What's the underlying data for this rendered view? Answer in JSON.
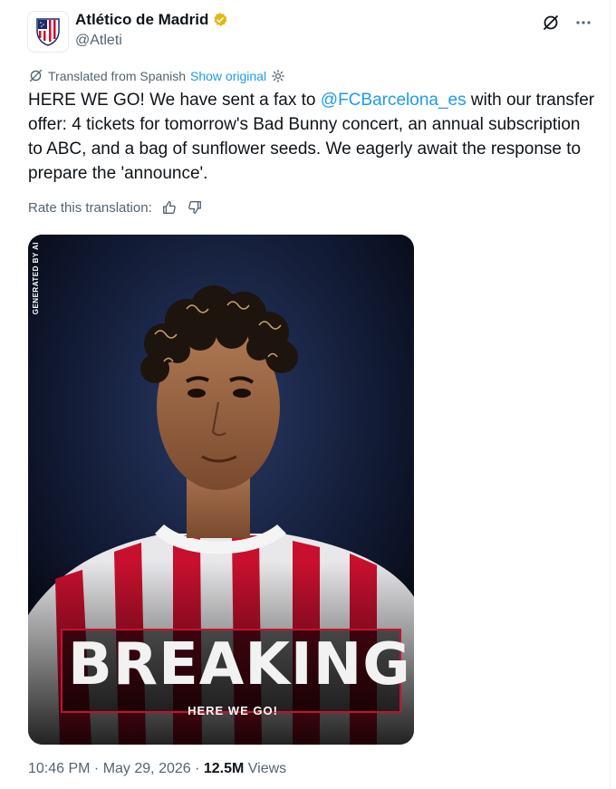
{
  "tweet": {
    "display_name": "Atlético de Madrid",
    "handle": "@Atleti",
    "translated_label": "Translated from Spanish",
    "show_original": "Show original",
    "text_part1": "HERE WE GO! We have sent a fax to ",
    "mention": "@FCBarcelona_es",
    "text_part2": " with our transfer offer: 4 tickets for tomorrow's Bad Bunny concert, an annual subscription to ABC, and a bag of sunflower seeds. We eagerly await the response to prepare the 'announce'.",
    "rate_label": "Rate this translation:",
    "time": "10:46 PM",
    "dot1": " · ",
    "date": "May 29, 2026",
    "dot2": " · ",
    "views_count": "12.5M",
    "views_label": " Views"
  },
  "media": {
    "generated_label": "GENERATED BY AI",
    "headline": "BREAKING",
    "subline": "HERE WE GO!"
  },
  "icons": {
    "verified": "verified-gold-icon",
    "grok": "grok-icon",
    "more": "more-icon",
    "translate": "translate-icon",
    "settings": "gear-icon",
    "thumbs_up": "thumbs-up-icon",
    "thumbs_down": "thumbs-down-icon"
  },
  "colors": {
    "accent": "#1d9bf0",
    "verified_gold": "#e2b719",
    "brand_red": "#c8102e"
  }
}
